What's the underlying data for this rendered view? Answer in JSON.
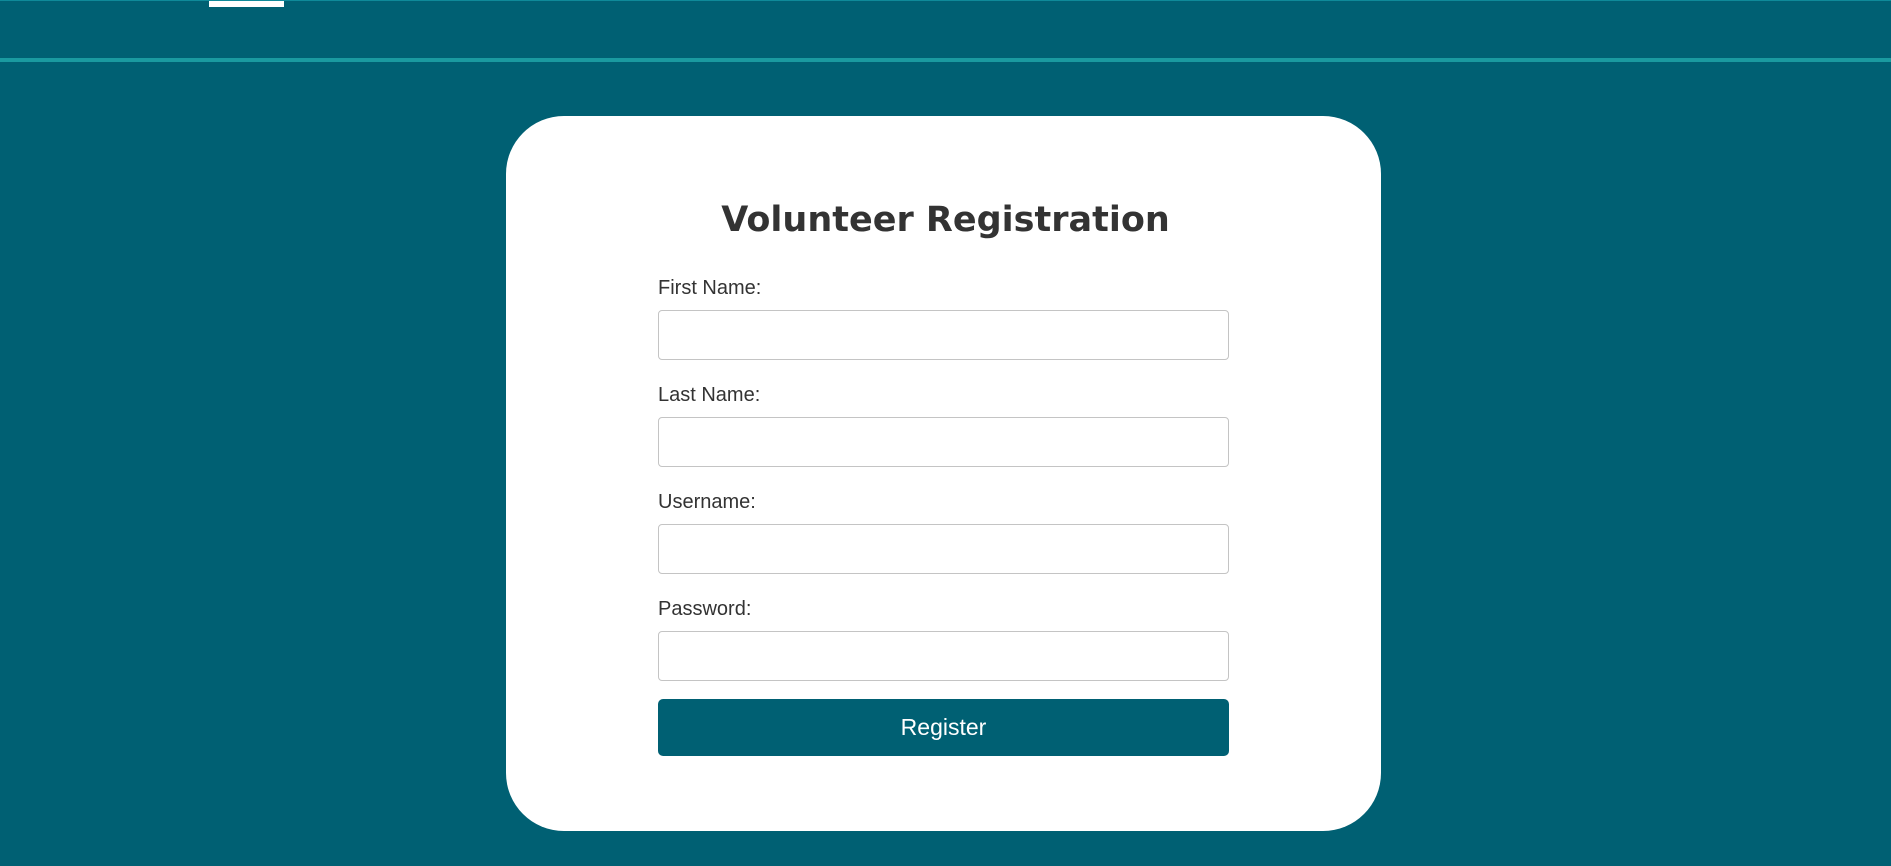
{
  "form": {
    "title": "Volunteer Registration",
    "fields": [
      {
        "label": "First Name:",
        "value": "",
        "placeholder": ""
      },
      {
        "label": "Last Name:",
        "value": "",
        "placeholder": ""
      },
      {
        "label": "Username:",
        "value": "",
        "placeholder": ""
      },
      {
        "label": "Password:",
        "value": "",
        "placeholder": ""
      }
    ],
    "submit_label": "Register"
  },
  "colors": {
    "background": "#006073",
    "card": "#ffffff",
    "button": "#006073",
    "nav_border": "#1a9aa0",
    "text": "#333333"
  }
}
